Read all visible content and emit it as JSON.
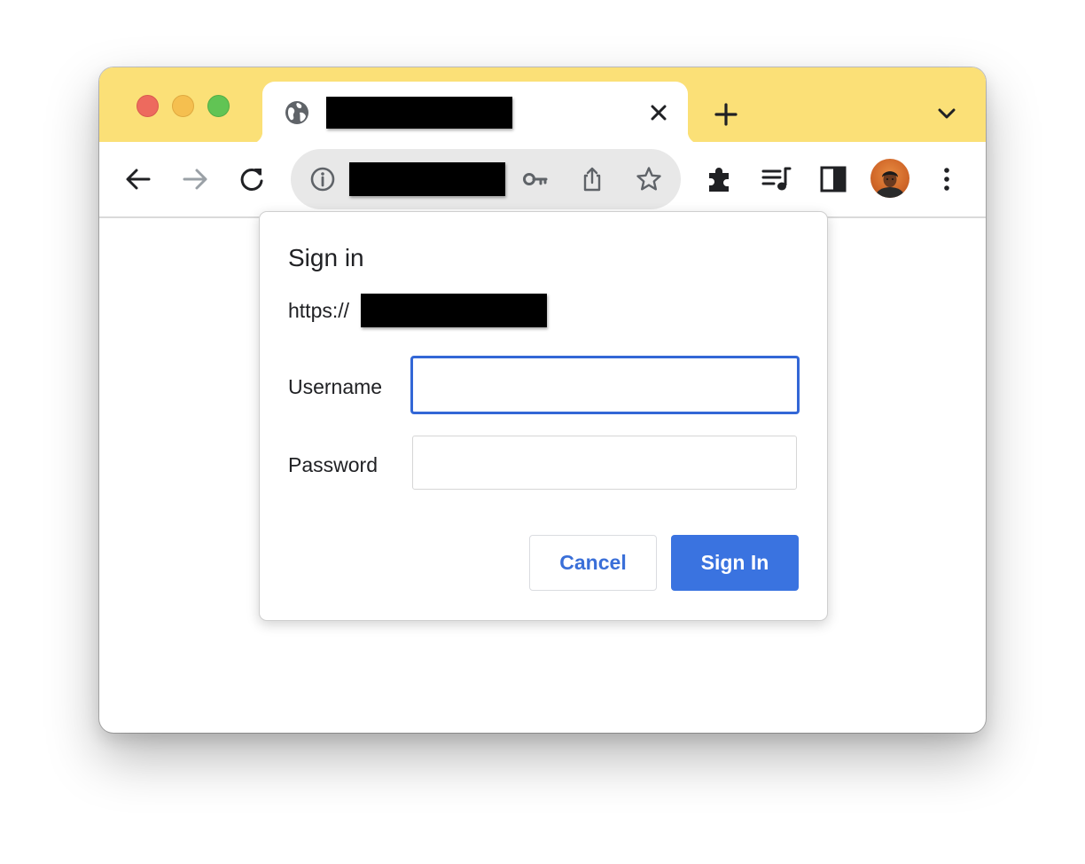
{
  "browser": {
    "tabs": [
      {
        "title": "",
        "favicon": "globe-icon",
        "close_icon": "close-icon"
      }
    ],
    "new_tab_icon": "plus-icon",
    "tab_search_icon": "chevron-down-icon",
    "toolbar": {
      "back_icon": "arrow-left-icon",
      "forward_icon": "arrow-right-icon",
      "reload_icon": "reload-icon",
      "site_info_icon": "info-icon",
      "address_value": "",
      "password_icon": "key-icon",
      "share_icon": "share-icon",
      "bookmark_icon": "star-icon",
      "extensions_icon": "puzzle-icon",
      "media_icon": "media-queue-icon",
      "side_panel_icon": "side-panel-icon",
      "menu_icon": "kebab-menu-icon"
    },
    "accent_color": "#fbe077"
  },
  "dialog": {
    "title": "Sign in",
    "origin_prefix": "https://",
    "username_label": "Username",
    "username_value": "",
    "password_label": "Password",
    "password_value": "",
    "cancel_label": "Cancel",
    "signin_label": "Sign In",
    "primary_color": "#3a73e0"
  }
}
